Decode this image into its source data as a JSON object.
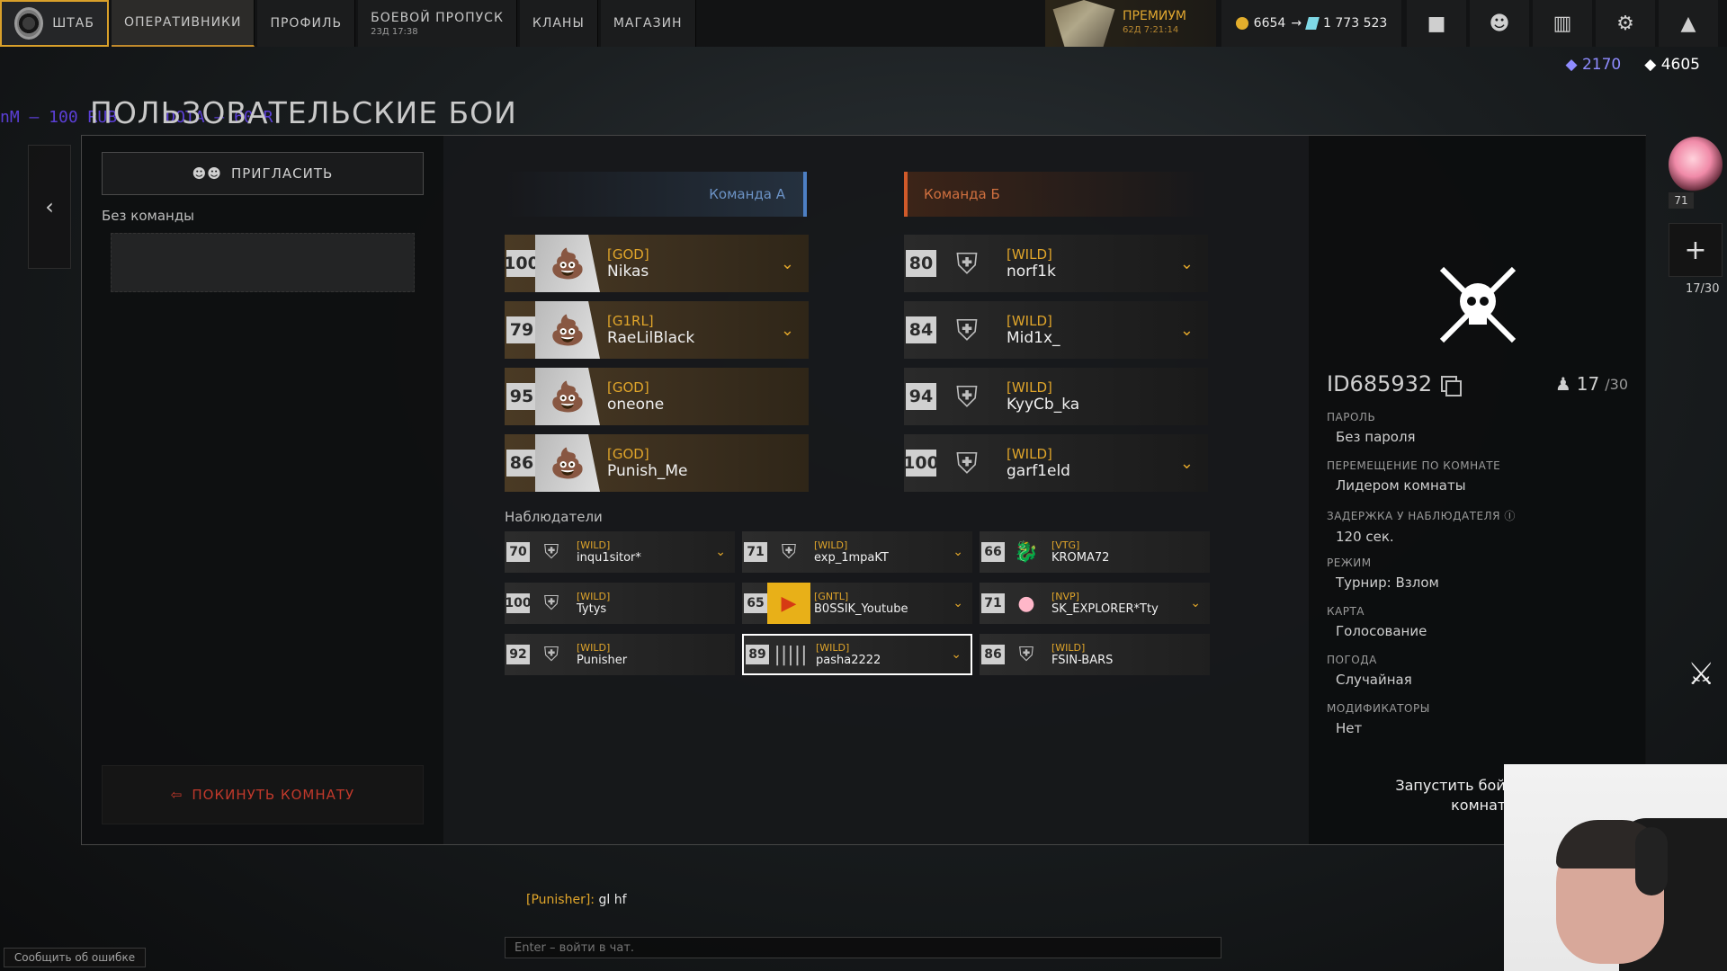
{
  "nav": {
    "home": "ШТАБ",
    "operatives": "ОПЕРАТИВНИКИ",
    "profile": "ПРОФИЛЬ",
    "battlepass": "БОЕВОЙ ПРОПУСК",
    "battlepass_sub": "23Д 17:38",
    "clans": "КЛАНЫ",
    "shop": "МАГАЗИН"
  },
  "premium": {
    "label": "ПРЕМИУМ",
    "sub": "62Д 7:21:14"
  },
  "currency": {
    "coins": "6654",
    "crystals": "1 773 523"
  },
  "top_balance": {
    "tokens": "2170",
    "diamonds": "4605"
  },
  "stream_overlay": "nM – 100 RUB     DOTA – 60 R",
  "page_title": "ПОЛЬЗОВАТЕЛЬСКИЕ БОИ",
  "left": {
    "invite": "ПРИГЛАСИТЬ",
    "no_team": "Без команды",
    "leave": "ПОКИНУТЬ КОМНАТУ"
  },
  "teams": {
    "a": {
      "label": "Команда A",
      "players": [
        {
          "level": "100",
          "clan": "[GOD]",
          "nick": "Nikas",
          "chevron": true
        },
        {
          "level": "79",
          "clan": "[G1RL]",
          "nick": "RaeLilBlack",
          "chevron": true
        },
        {
          "level": "95",
          "clan": "[GOD]",
          "nick": "oneone",
          "chevron": false
        },
        {
          "level": "86",
          "clan": "[GOD]",
          "nick": "Punish_Me",
          "chevron": false
        }
      ]
    },
    "b": {
      "label": "Команда Б",
      "players": [
        {
          "level": "80",
          "clan": "[WILD]",
          "nick": "norf1k",
          "chevron": true
        },
        {
          "level": "84",
          "clan": "[WILD]",
          "nick": "Mid1x_",
          "chevron": true
        },
        {
          "level": "94",
          "clan": "[WILD]",
          "nick": "KyyCb_ka",
          "chevron": false
        },
        {
          "level": "100",
          "clan": "[WILD]",
          "nick": "garf1eld",
          "chevron": true
        }
      ]
    }
  },
  "observers": {
    "title": "Наблюдатели",
    "list": [
      {
        "level": "70",
        "clan": "[WILD]",
        "nick": "inqu1sitor*",
        "chevron": true,
        "avatar": "shield"
      },
      {
        "level": "71",
        "clan": "[WILD]",
        "nick": "exp_1mpaKT",
        "chevron": true,
        "avatar": "shield"
      },
      {
        "level": "66",
        "clan": "[VTG]",
        "nick": "KROMA72",
        "chevron": false,
        "avatar": "dragon"
      },
      {
        "level": "100",
        "clan": "[WILD]",
        "nick": "Tytys",
        "chevron": false,
        "avatar": "shield"
      },
      {
        "level": "65",
        "clan": "[GNTL]",
        "nick": "B0SSIK_Youtube",
        "chevron": true,
        "avatar": "youtube"
      },
      {
        "level": "71",
        "clan": "[NVP]",
        "nick": "SK_EXPLORER*Tty",
        "chevron": true,
        "avatar": "icecream"
      },
      {
        "level": "92",
        "clan": "[WILD]",
        "nick": "Punisher",
        "chevron": false,
        "avatar": "shield"
      },
      {
        "level": "89",
        "clan": "[WILD]",
        "nick": "pasha2222",
        "chevron": true,
        "avatar": "barcode"
      },
      {
        "level": "86",
        "clan": "[WILD]",
        "nick": "FSIN-BARS",
        "chevron": false,
        "avatar": "shield"
      }
    ]
  },
  "room": {
    "id": "ID685932",
    "count": "17",
    "max": "/30",
    "password_label": "ПАРОЛЬ",
    "password_value": "Без пароля",
    "movement_label": "ПЕРЕМЕЩЕНИЕ ПО КОМНАТЕ",
    "movement_value": "Лидером комнаты",
    "delay_label": "ЗАДЕРЖКА У НАБЛЮДАТЕЛЯ",
    "delay_value": "120 сек.",
    "mode_label": "РЕЖИМ",
    "mode_value": "Турнир: Взлом",
    "map_label": "КАРТА",
    "map_value": "Голосование",
    "weather_label": "ПОГОДА",
    "weather_value": "Случайная",
    "modifiers_label": "МОДИФИКАТОРЫ",
    "modifiers_value": "Нет",
    "start_text": "Запустить бой может т\nкомнаты"
  },
  "sidebar": {
    "avatar_level": "71",
    "count": "17/30"
  },
  "chat": {
    "author": "[Punisher]:",
    "message": " gl hf",
    "input_placeholder": "Enter – войти в чат."
  },
  "bug_report": "Сообщить об ошибке"
}
